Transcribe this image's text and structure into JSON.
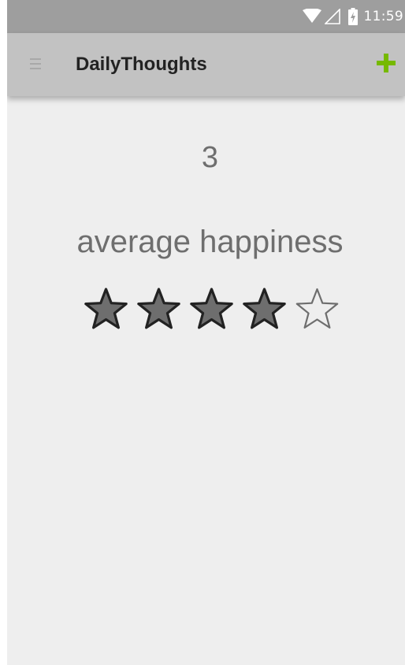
{
  "status_bar": {
    "time": "11:59",
    "icons": [
      "wifi-icon",
      "cell-signal-icon",
      "battery-charging-icon"
    ]
  },
  "app_bar": {
    "menu_icon": "hamburger-menu-icon",
    "title": "DailyThoughts",
    "add_icon": "plus-icon"
  },
  "summary": {
    "value": "3",
    "label": "average happiness",
    "rating": 4,
    "rating_max": 5
  },
  "colors": {
    "status_bar": "#9e9e9e",
    "app_bar": "#c2c2c2",
    "background": "#eeeeee",
    "accent_add": "#76b900",
    "text": "#6e6e6e",
    "star_fill": "#6e6e6e",
    "star_outline": "#222222"
  }
}
